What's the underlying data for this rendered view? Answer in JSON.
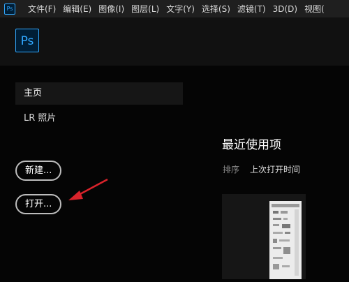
{
  "menubar": {
    "app_icon": "Ps",
    "items": [
      "文件(F)",
      "编辑(E)",
      "图像(I)",
      "图层(L)",
      "文字(Y)",
      "选择(S)",
      "滤镜(T)",
      "3D(D)",
      "视图("
    ]
  },
  "header": {
    "logo": "Ps"
  },
  "sidebar": {
    "items": [
      "主页",
      "LR 照片"
    ]
  },
  "buttons": {
    "new": "新建...",
    "open": "打开..."
  },
  "recent": {
    "title": "最近使用项",
    "sort_label": "排序",
    "sort_value": "上次打开时间"
  },
  "annotation": {
    "arrow_color": "#d9232b"
  },
  "colors": {
    "brand": "#31a8ff"
  }
}
